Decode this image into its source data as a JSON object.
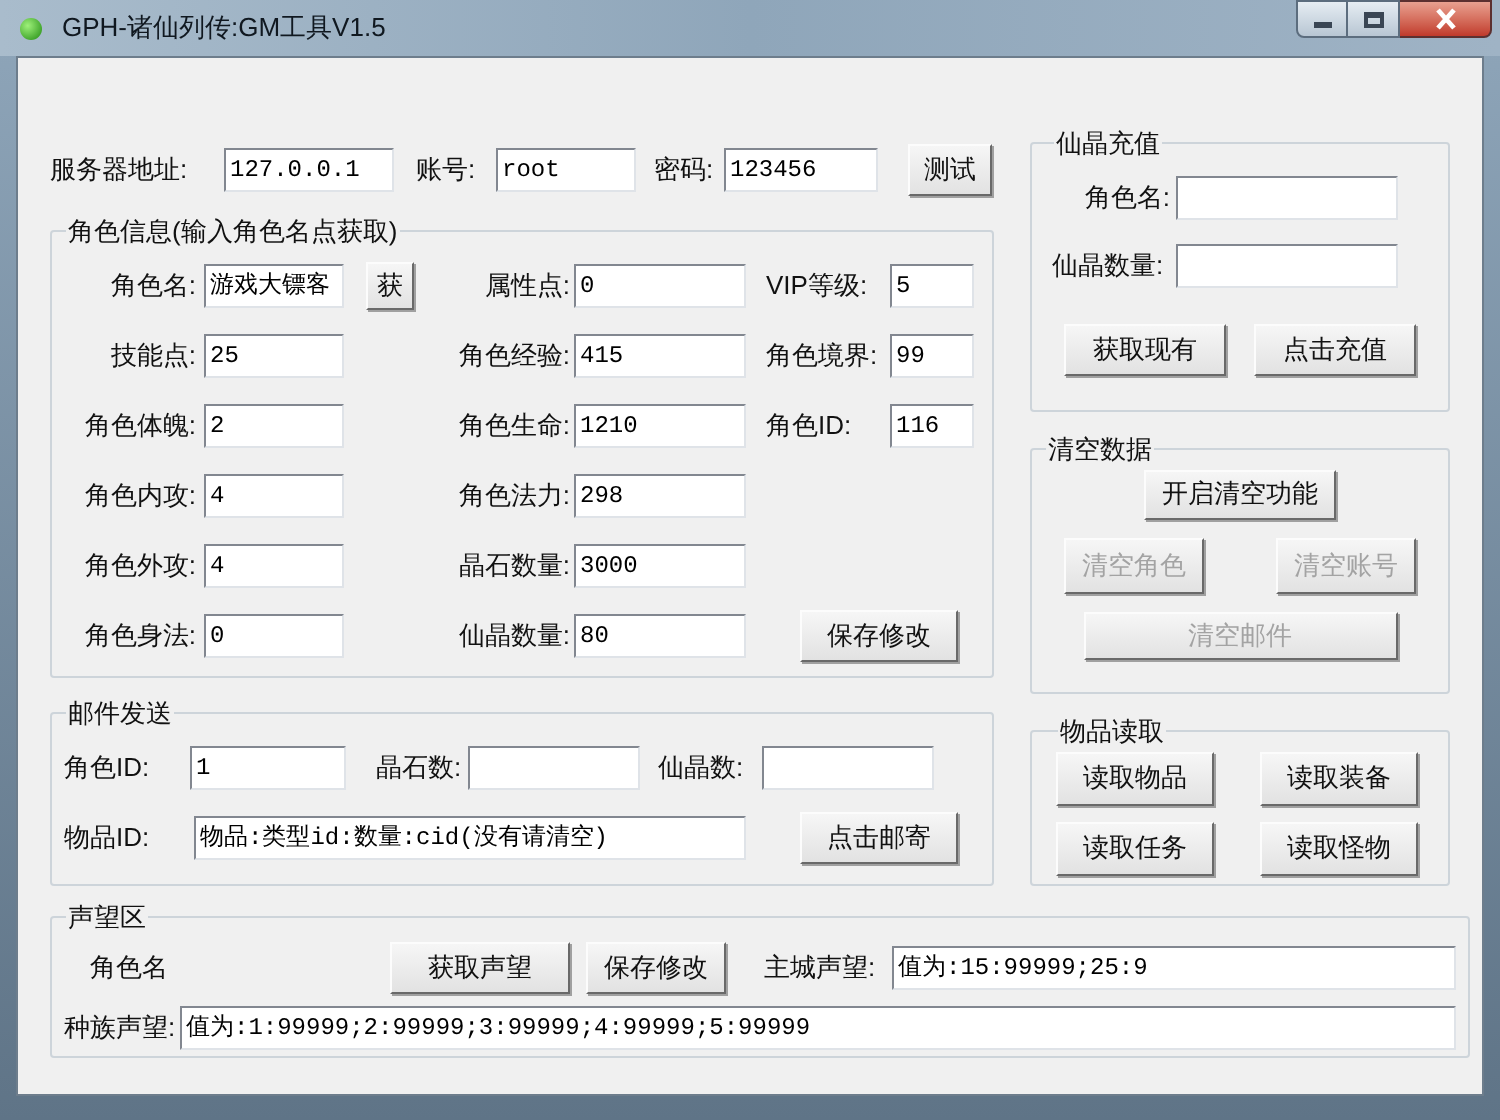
{
  "window": {
    "title": "GPH-诸仙列传:GM工具V1.5"
  },
  "server": {
    "fields": [
      {
        "label": "服务器地址:",
        "value": "127.0.0.1"
      },
      {
        "label": "账号:",
        "value": "root"
      },
      {
        "label": "密码:",
        "value": "123456"
      }
    ],
    "test_button": "测试"
  },
  "role_info": {
    "legend": "角色信息(输入角色名点获取)",
    "fetch_button": "获",
    "save_button": "保存修改",
    "rows": [
      [
        {
          "label": "角色名:",
          "value": "游戏大镖客"
        },
        {
          "label": "属性点:",
          "value": "0"
        },
        {
          "label": "VIP等级:",
          "value": "5"
        }
      ],
      [
        {
          "label": "技能点:",
          "value": "25"
        },
        {
          "label": "角色经验:",
          "value": "415"
        },
        {
          "label": "角色境界:",
          "value": "99"
        }
      ],
      [
        {
          "label": "角色体魄:",
          "value": "2"
        },
        {
          "label": "角色生命:",
          "value": "1210"
        },
        {
          "label": "角色ID:",
          "value": "116"
        }
      ],
      [
        {
          "label": "角色内攻:",
          "value": "4"
        },
        {
          "label": "角色法力:",
          "value": "298"
        }
      ],
      [
        {
          "label": "角色外攻:",
          "value": "4"
        },
        {
          "label": "晶石数量:",
          "value": "3000"
        }
      ],
      [
        {
          "label": "角色身法:",
          "value": "0"
        },
        {
          "label": "仙晶数量:",
          "value": "80"
        }
      ]
    ]
  },
  "mail": {
    "legend": "邮件发送",
    "fields": [
      {
        "label": "角色ID:",
        "value": "1"
      },
      {
        "label": "晶石数:"
      },
      {
        "label": "仙晶数:"
      },
      {
        "label": "物品ID:",
        "value": "物品:类型id:数量:cid(没有请清空)"
      }
    ],
    "send_button": "点击邮寄"
  },
  "reputation": {
    "legend": "声望区",
    "name_label": "角色名",
    "buttons": [
      "获取声望",
      "保存修改"
    ],
    "fields": [
      {
        "label": "主城声望:",
        "value": "值为:15:99999;25:9"
      },
      {
        "label": "种族声望:",
        "value": "值为:1:99999;2:99999;3:99999;4:99999;5:99999"
      }
    ]
  },
  "recharge": {
    "legend": "仙晶充值",
    "fields": [
      {
        "label": "角色名:"
      },
      {
        "label": "仙晶数量:"
      }
    ],
    "buttons": [
      "获取现有",
      "点击充值"
    ]
  },
  "clear_data": {
    "legend": "清空数据",
    "buttons": [
      {
        "label": "开启清空功能",
        "disabled": false
      },
      {
        "label": "清空角色",
        "disabled": true
      },
      {
        "label": "清空账号",
        "disabled": true
      },
      {
        "label": "清空邮件",
        "disabled": true
      }
    ]
  },
  "item_read": {
    "legend": "物品读取",
    "buttons": [
      "读取物品",
      "读取装备",
      "读取任务",
      "读取怪物"
    ]
  }
}
